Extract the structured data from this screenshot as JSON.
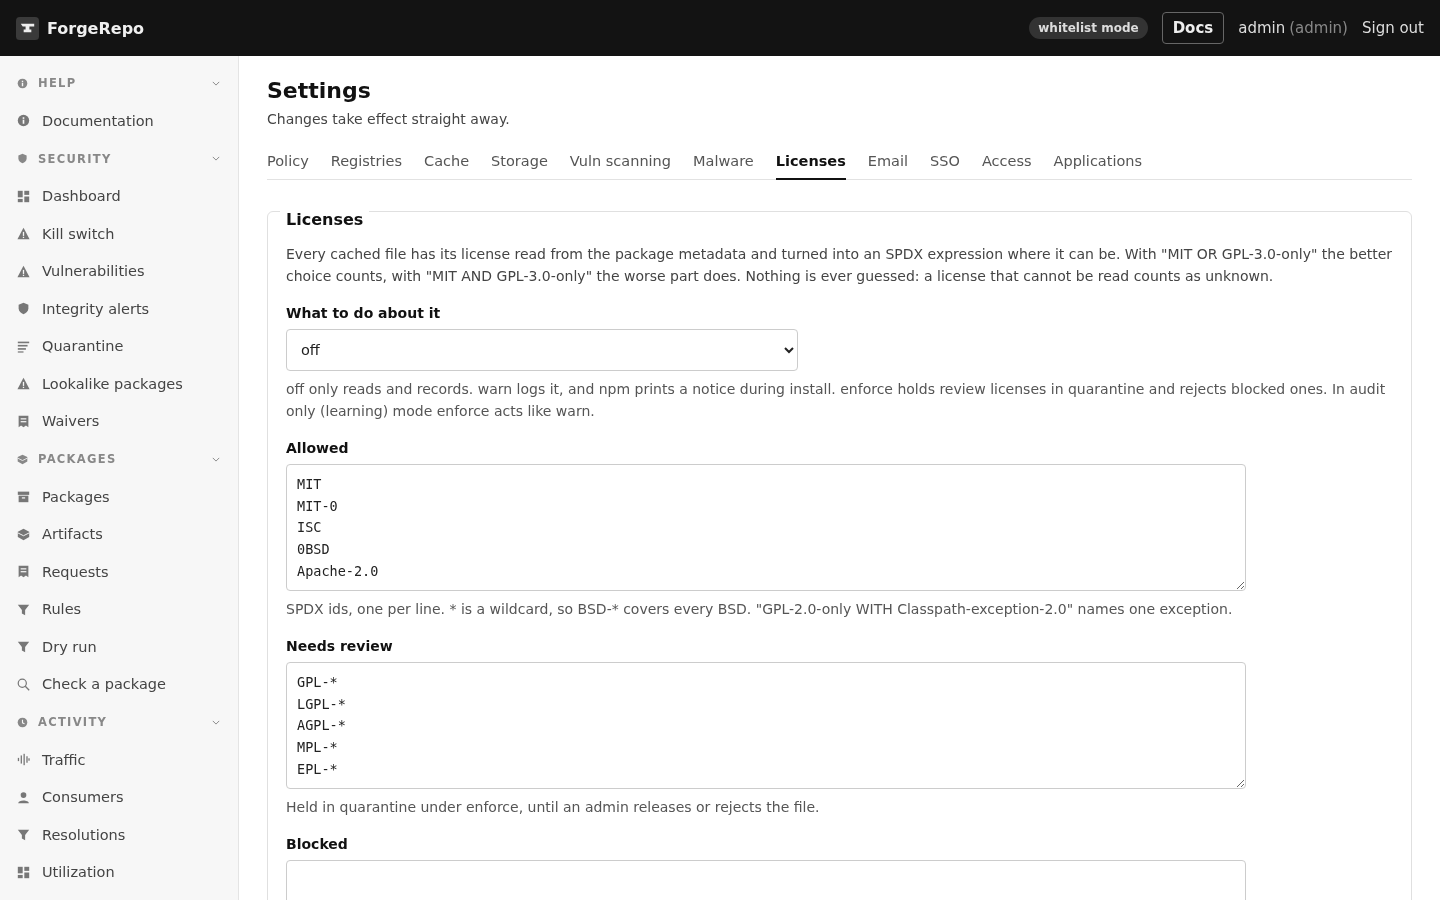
{
  "header": {
    "brand": "ForgeRepo",
    "mode_badge": "whitelist mode",
    "docs_button": "Docs",
    "user": "admin",
    "role": "(admin)",
    "sign_out": "Sign out"
  },
  "sidebar": {
    "sections": [
      {
        "title": "HELP",
        "expanded": true,
        "items": [
          {
            "label": "Documentation"
          }
        ]
      },
      {
        "title": "SECURITY",
        "expanded": true,
        "items": [
          {
            "label": "Dashboard"
          },
          {
            "label": "Kill switch"
          },
          {
            "label": "Vulnerabilities"
          },
          {
            "label": "Integrity alerts"
          },
          {
            "label": "Quarantine"
          },
          {
            "label": "Lookalike packages"
          },
          {
            "label": "Waivers"
          }
        ]
      },
      {
        "title": "PACKAGES",
        "expanded": true,
        "items": [
          {
            "label": "Packages"
          },
          {
            "label": "Artifacts"
          },
          {
            "label": "Requests"
          },
          {
            "label": "Rules"
          },
          {
            "label": "Dry run"
          },
          {
            "label": "Check a package"
          }
        ]
      },
      {
        "title": "ACTIVITY",
        "expanded": true,
        "items": [
          {
            "label": "Traffic"
          },
          {
            "label": "Consumers"
          },
          {
            "label": "Resolutions"
          },
          {
            "label": "Utilization"
          }
        ]
      }
    ]
  },
  "page": {
    "title": "Settings",
    "subtitle": "Changes take effect straight away.",
    "tabs": [
      {
        "label": "Policy",
        "selected": false
      },
      {
        "label": "Registries",
        "selected": false
      },
      {
        "label": "Cache",
        "selected": false
      },
      {
        "label": "Storage",
        "selected": false
      },
      {
        "label": "Vuln scanning",
        "selected": false
      },
      {
        "label": "Malware",
        "selected": false
      },
      {
        "label": "Licenses",
        "selected": true
      },
      {
        "label": "Email",
        "selected": false
      },
      {
        "label": "SSO",
        "selected": false
      },
      {
        "label": "Access",
        "selected": false
      },
      {
        "label": "Applications",
        "selected": false
      }
    ],
    "panel": {
      "title": "Licenses",
      "description": "Every cached file has its license read from the package metadata and turned into an SPDX expression where it can be. With \"MIT OR GPL-3.0-only\" the better choice counts, with \"MIT AND GPL-3.0-only\" the worse part does. Nothing is ever guessed: a license that cannot be read counts as unknown.",
      "fields": [
        {
          "kind": "select",
          "label": "What to do about it",
          "value": "off",
          "help": "off only reads and records. warn logs it, and npm prints a notice during install. enforce holds review licenses in quarantine and rejects blocked ones. In audit only (learning) mode enforce acts like warn."
        },
        {
          "kind": "textarea",
          "label": "Allowed",
          "lines": [
            "MIT",
            "MIT-0",
            "ISC",
            "0BSD",
            "Apache-2.0"
          ],
          "help": "SPDX ids, one per line. * is a wildcard, so BSD-* covers every BSD. \"GPL-2.0-only WITH Classpath-exception-2.0\" names one exception."
        },
        {
          "kind": "textarea",
          "label": "Needs review",
          "lines": [
            "GPL-*",
            "LGPL-*",
            "AGPL-*",
            "MPL-*",
            "EPL-*"
          ],
          "help": "Held in quarantine under enforce, until an admin releases or rejects the file."
        },
        {
          "kind": "textarea",
          "label": "Blocked"
        }
      ]
    }
  }
}
